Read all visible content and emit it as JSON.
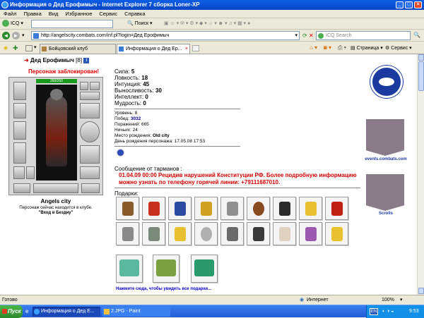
{
  "window": {
    "title": "Информация о Дед Ерофимыч - Internet Explorer 7 сборка Loner-XP"
  },
  "menu": [
    "Файл",
    "Правка",
    "Вид",
    "Избранное",
    "Сервис",
    "Справка"
  ],
  "toolbar": {
    "icq": "ICQ",
    "search": "Поиск"
  },
  "address": {
    "url": "http://angelscity.combats.com/inf.pl?login=Дед Ерофимыч",
    "icq_search_placeholder": "ICQ Search"
  },
  "tabs": [
    "Бойцовский клуб",
    "Информация о Дед Ер..."
  ],
  "cmdbar": {
    "page": "Страница",
    "service": "Сервис"
  },
  "profile": {
    "name": "Дед Ерофимыч",
    "level": "[8]",
    "blocked": "Персонаж заблокирован!",
    "hp": "260/260",
    "city": "Angels city",
    "location_line1": "Персонаж сейчас находится в клубе.",
    "location_line2": "\"Вход в Бездну\"",
    "stats": [
      {
        "label": "Сила:",
        "value": "5"
      },
      {
        "label": "Ловкость:",
        "value": "18"
      },
      {
        "label": "Интуиция:",
        "value": "45"
      },
      {
        "label": "Выносливость:",
        "value": "30"
      },
      {
        "label": "Интеллект:",
        "value": "0"
      },
      {
        "label": "Мудрость:",
        "value": "0"
      }
    ],
    "info": [
      {
        "label": "Уровень:",
        "value": "8"
      },
      {
        "label": "Побед:",
        "value": "3032"
      },
      {
        "label": "Поражений:",
        "value": "665"
      },
      {
        "label": "Ничьих:",
        "value": "24"
      },
      {
        "label": "Место рождения:",
        "value": "Old city"
      },
      {
        "label": "День рождения персонажа:",
        "value": "17.05.08 17:53"
      }
    ],
    "message_title": "Сообщение от тарманов :",
    "message": "01.04.09 00:00 Рецидив нарушений Конституции РФ. Более подробную информацию можно узнать по телефону горячей линии: +79111687010.",
    "gifts_title": "Подарки:",
    "gifts_link": "Нажмите сюда, чтобы увидеть все подарки...",
    "side_events": "events.combats.com",
    "side_scrolls": "Scrolls"
  },
  "status": {
    "left": "Готово",
    "zone": "Интернет",
    "zoom": "100%"
  },
  "taskbar": {
    "start": "Пуск",
    "task1": "Информация о Дед Е...",
    "task2": "2.JPG - Paint",
    "lang": "EN",
    "time": "9:53"
  },
  "colors": {
    "blocked": "#e00000",
    "message": "#d00000",
    "link": "#0000c0"
  }
}
